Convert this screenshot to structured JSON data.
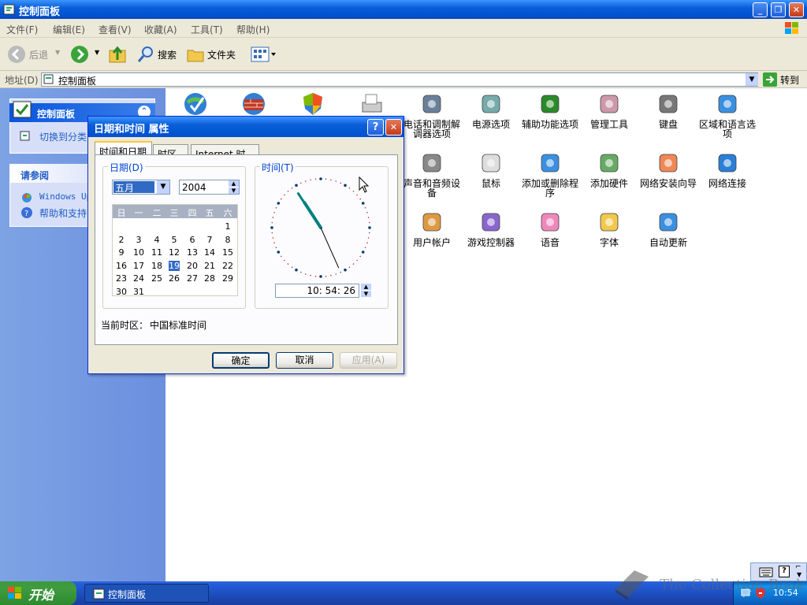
{
  "window": {
    "title": "控制面板",
    "buttons": {
      "minimize": "_",
      "restore": "❐",
      "close": "✕"
    }
  },
  "menu": [
    "文件(F)",
    "编辑(E)",
    "查看(V)",
    "收藏(A)",
    "工具(T)",
    "帮助(H)"
  ],
  "toolbar": {
    "back": "后退",
    "search": "搜索",
    "folders": "文件夹"
  },
  "address": {
    "label": "地址(D)",
    "value": "控制面板",
    "go": "转到"
  },
  "left_pane": {
    "panel_title": "控制面板",
    "switch_view": "切换到分类",
    "see_also_title": "请参阅",
    "links": [
      "Windows Up",
      "帮助和支持"
    ]
  },
  "icons": [
    {
      "label": "电话和调制解调器选项",
      "name": "phone-modem-icon"
    },
    {
      "label": "电源选项",
      "name": "power-options-icon"
    },
    {
      "label": "辅助功能选项",
      "name": "accessibility-icon"
    },
    {
      "label": "管理工具",
      "name": "admin-tools-icon"
    },
    {
      "label": "键盘",
      "name": "keyboard-icon"
    },
    {
      "label": "区域和语言选项",
      "name": "globe-icon"
    },
    {
      "label": "声音和音频设备",
      "name": "speaker-icon"
    },
    {
      "label": "鼠标",
      "name": "mouse-icon"
    },
    {
      "label": "添加或删除程序",
      "name": "add-remove-programs-icon"
    },
    {
      "label": "添加硬件",
      "name": "add-hardware-icon"
    },
    {
      "label": "网络安装向导",
      "name": "network-setup-icon"
    },
    {
      "label": "网络连接",
      "name": "network-connections-icon"
    },
    {
      "label": "用户帐户",
      "name": "user-accounts-icon"
    },
    {
      "label": "游戏控制器",
      "name": "game-controller-icon"
    },
    {
      "label": "语音",
      "name": "speech-icon"
    },
    {
      "label": "字体",
      "name": "fonts-icon"
    },
    {
      "label": "自动更新",
      "name": "automatic-updates-icon"
    }
  ],
  "dialog": {
    "title": "日期和时间 属性",
    "help": "?",
    "close": "✕",
    "tabs": [
      "时间和日期",
      "时区",
      "Internet 时间"
    ],
    "date_group": "日期(D)",
    "time_group": "时间(T)",
    "month": "五月",
    "year": "2004",
    "weekdays": [
      "日",
      "一",
      "二",
      "三",
      "四",
      "五",
      "六"
    ],
    "calendar": [
      [
        "",
        "",
        "",
        "",
        "",
        "",
        "1"
      ],
      [
        "2",
        "3",
        "4",
        "5",
        "6",
        "7",
        "8"
      ],
      [
        "9",
        "10",
        "11",
        "12",
        "13",
        "14",
        "15"
      ],
      [
        "16",
        "17",
        "18",
        "19",
        "20",
        "21",
        "22"
      ],
      [
        "23",
        "24",
        "25",
        "26",
        "27",
        "28",
        "29"
      ],
      [
        "30",
        "31",
        "",
        "",
        "",
        "",
        ""
      ]
    ],
    "selected_day": "19",
    "time": "10: 54: 26",
    "clock": {
      "hour": 10,
      "minute": 54,
      "second": 26
    },
    "timezone_label": "当前时区：",
    "timezone_value": "中国标准时间",
    "ok": "确定",
    "cancel": "取消",
    "apply": "应用(A)"
  },
  "taskbar": {
    "start": "开始",
    "task": "控制面板",
    "clock": "10:54"
  },
  "watermark": "The Collection Book"
}
